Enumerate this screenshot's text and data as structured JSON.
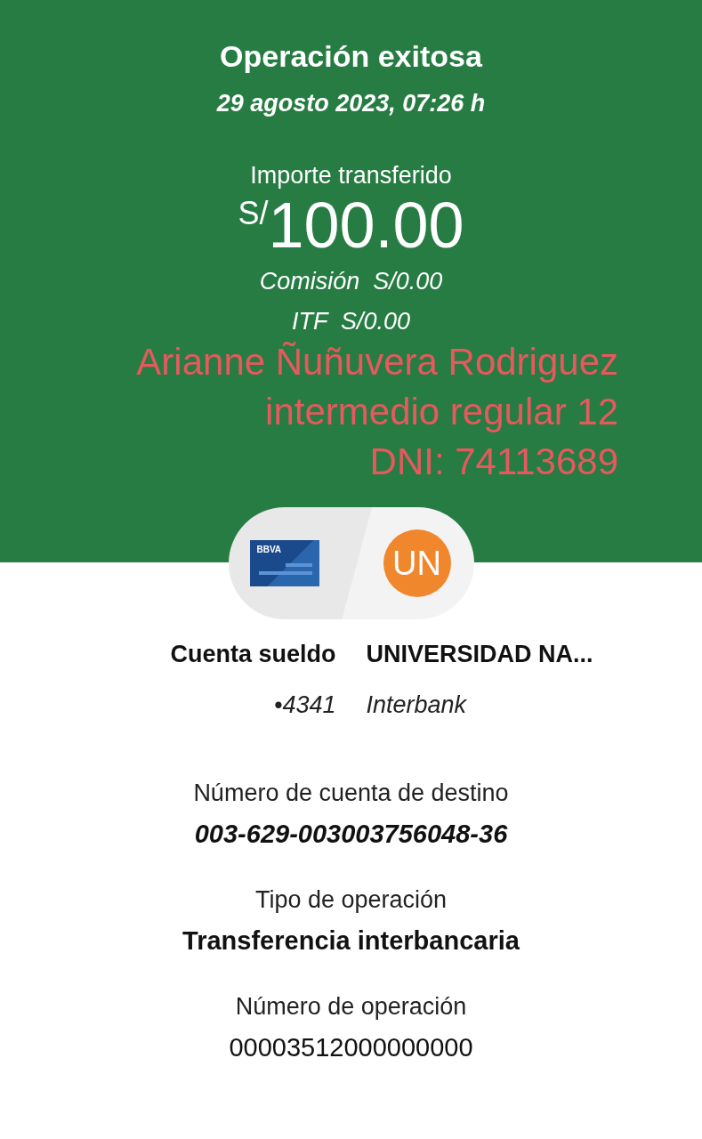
{
  "header": {
    "title": "Operación exitosa",
    "datetime": "29 agosto 2023, 07:26 h",
    "amount_label": "Importe transferido",
    "currency": "S/",
    "amount": "100.00",
    "fees": [
      {
        "label": "Comisión",
        "value": "S/0.00"
      },
      {
        "label": "ITF",
        "value": "S/0.00"
      }
    ]
  },
  "overlay_note": [
    "Arianne Ñuñuvera Rodriguez",
    "intermedio regular 12",
    "DNI: 74113689"
  ],
  "transfer": {
    "source_logo": "BBVA",
    "destination_initials": "UN"
  },
  "accounts": {
    "source": {
      "name": "Cuenta sueldo",
      "detail": "•4341"
    },
    "destination": {
      "name": "UNIVERSIDAD NA...",
      "detail": "Interbank"
    }
  },
  "details": [
    {
      "label": "Número de cuenta de destino",
      "value": "003-629-003003756048-36",
      "kind": "italic"
    },
    {
      "label": "Tipo de operación",
      "value": "Transferencia interbancaria",
      "kind": "bold"
    },
    {
      "label": "Número de operación",
      "value": "00003512000000000",
      "kind": "plain"
    }
  ]
}
